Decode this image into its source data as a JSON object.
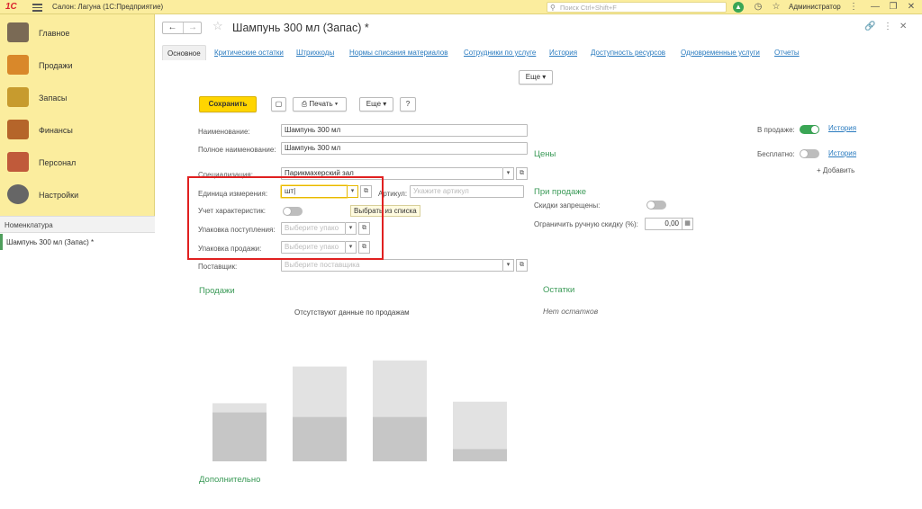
{
  "topbar": {
    "logo": "1С",
    "app_title": "Салон: Лагуна  (1С:Предприятие)",
    "search_placeholder": "Поиск Ctrl+Shift+F",
    "user": "Администратор"
  },
  "sidebar": {
    "items": [
      {
        "label": "Главное",
        "icon": "home-icon",
        "color": "#7a6a55"
      },
      {
        "label": "Продажи",
        "icon": "sales-chart-icon",
        "color": "#d9882a"
      },
      {
        "label": "Запасы",
        "icon": "stock-icon",
        "color": "#c79b2e"
      },
      {
        "label": "Финансы",
        "icon": "wallet-icon",
        "color": "#b5652a"
      },
      {
        "label": "Персонал",
        "icon": "people-icon",
        "color": "#c05a3a"
      },
      {
        "label": "Настройки",
        "icon": "gear-icon",
        "color": "#666666"
      }
    ],
    "panel_title": "Номенклатура",
    "open_item": "Шампунь 300 мл (Запас) *"
  },
  "header": {
    "title": "Шампунь 300 мл (Запас) *"
  },
  "tabs": [
    "Основное",
    "Критические остатки",
    "Штрихкоды",
    "Нормы списания материалов",
    "Сотрудники по услуге",
    "История",
    "Доступность ресурсов",
    "Одновременные услуги",
    "Отчеты"
  ],
  "toolbar": {
    "more_top": "Еще",
    "save": "Сохранить",
    "print": "Печать",
    "more": "Еще",
    "help": "?"
  },
  "form": {
    "name_label": "Наименование:",
    "name_value": "Шампунь 300 мл",
    "fullname_label": "Полное наименование:",
    "fullname_value": "Шампунь 300 мл",
    "spec_label": "Специализация:",
    "spec_value": "Парикмахерский зал",
    "unit_label": "Единица измерения:",
    "unit_value": "шт",
    "article_label": "Артикул:",
    "article_placeholder": "Укажите артикул",
    "chars_label": "Учет характеристик:",
    "pack_in_label": "Упаковка поступления:",
    "pack_in_placeholder": "Выберите упако",
    "pack_out_label": "Упаковка продажи:",
    "pack_out_placeholder": "Выберите упако",
    "supplier_label": "Поставщик:",
    "supplier_placeholder": "Выберите поставщика",
    "tooltip": "Выбрать из списка"
  },
  "right": {
    "on_sale_label": "В продаже:",
    "history1": "История",
    "free_label": "Бесплатно:",
    "history2": "История",
    "add": "+ Добавить",
    "prices_title": "Цены",
    "on_sale_title": "При продаже",
    "discounts_label": "Скидки запрещены:",
    "limit_label": "Ограничить ручную скидку (%):",
    "limit_value": "0,00"
  },
  "sales": {
    "title": "Продажи",
    "no_data": "Отсутствуют данные по продажам"
  },
  "stock": {
    "title": "Остатки",
    "none": "Нет остатков"
  },
  "extra_title": "Дополнительно",
  "placeholder_chart": {
    "bars": [
      {
        "total": 0.38,
        "dark": 0.32
      },
      {
        "total": 0.62,
        "dark": 0.29
      },
      {
        "total": 0.66,
        "dark": 0.29
      },
      {
        "total": 0.39,
        "dark": 0.08
      }
    ]
  },
  "colors": {
    "accent_green": "#3aa655",
    "save_yellow": "#ffd500",
    "link_blue": "#2a7bbf",
    "highlight_red": "#e02020"
  }
}
